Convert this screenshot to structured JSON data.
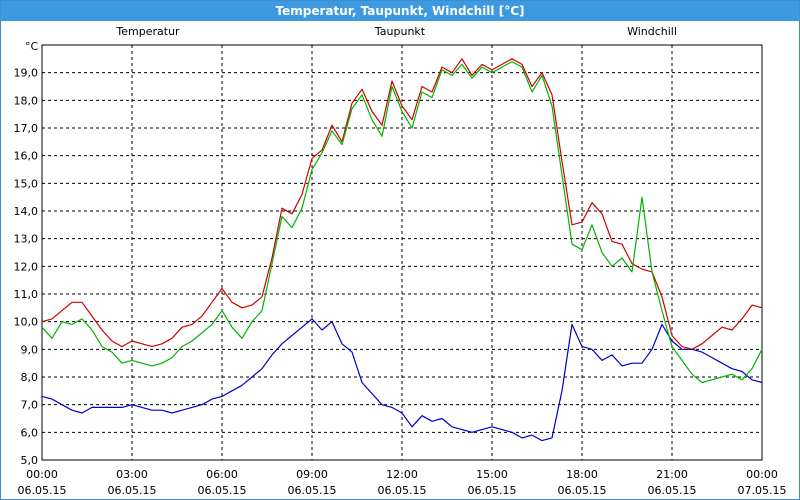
{
  "window": {
    "title": "Temperatur, Taupunkt, Windchill [°C]"
  },
  "chart_data": {
    "type": "line",
    "ylabel": "°C",
    "ylim": [
      5.0,
      20.0
    ],
    "xlim": [
      "2015-05-06T00:00",
      "2015-05-07T00:00"
    ],
    "grid": true,
    "yticks": [
      "5,0",
      "6,0",
      "7,0",
      "8,0",
      "9,0",
      "10,0",
      "11,0",
      "12,0",
      "13,0",
      "14,0",
      "15,0",
      "16,0",
      "17,0",
      "18,0",
      "19,0"
    ],
    "xticks": [
      {
        "time": "00:00",
        "date": "06.05.15"
      },
      {
        "time": "03:00",
        "date": "06.05.15"
      },
      {
        "time": "06:00",
        "date": "06.05.15"
      },
      {
        "time": "09:00",
        "date": "06.05.15"
      },
      {
        "time": "12:00",
        "date": "06.05.15"
      },
      {
        "time": "15:00",
        "date": "06.05.15"
      },
      {
        "time": "18:00",
        "date": "06.05.15"
      },
      {
        "time": "21:00",
        "date": "06.05.15"
      },
      {
        "time": "00:00",
        "date": "07.05.15"
      }
    ],
    "legend_placement": "top",
    "series": [
      {
        "name": "Temperatur",
        "color": "#d00000",
        "points": [
          [
            "00:00",
            10.0
          ],
          [
            "00:20",
            10.1
          ],
          [
            "00:40",
            10.4
          ],
          [
            "01:00",
            10.7
          ],
          [
            "01:20",
            10.7
          ],
          [
            "01:40",
            10.2
          ],
          [
            "02:00",
            9.7
          ],
          [
            "02:20",
            9.3
          ],
          [
            "02:40",
            9.1
          ],
          [
            "03:00",
            9.3
          ],
          [
            "03:20",
            9.2
          ],
          [
            "03:40",
            9.1
          ],
          [
            "04:00",
            9.2
          ],
          [
            "04:20",
            9.4
          ],
          [
            "04:40",
            9.8
          ],
          [
            "05:00",
            9.9
          ],
          [
            "05:20",
            10.2
          ],
          [
            "05:40",
            10.7
          ],
          [
            "06:00",
            11.2
          ],
          [
            "06:20",
            10.7
          ],
          [
            "06:40",
            10.5
          ],
          [
            "07:00",
            10.6
          ],
          [
            "07:20",
            10.9
          ],
          [
            "07:40",
            12.3
          ],
          [
            "08:00",
            14.1
          ],
          [
            "08:20",
            13.9
          ],
          [
            "08:40",
            14.6
          ],
          [
            "09:00",
            15.9
          ],
          [
            "09:20",
            16.2
          ],
          [
            "09:40",
            17.1
          ],
          [
            "10:00",
            16.5
          ],
          [
            "10:20",
            17.9
          ],
          [
            "10:40",
            18.4
          ],
          [
            "11:00",
            17.6
          ],
          [
            "11:20",
            17.1
          ],
          [
            "11:40",
            18.7
          ],
          [
            "12:00",
            17.8
          ],
          [
            "12:20",
            17.3
          ],
          [
            "12:40",
            18.5
          ],
          [
            "13:00",
            18.3
          ],
          [
            "13:20",
            19.2
          ],
          [
            "13:40",
            19.0
          ],
          [
            "14:00",
            19.5
          ],
          [
            "14:20",
            18.9
          ],
          [
            "14:40",
            19.3
          ],
          [
            "15:00",
            19.1
          ],
          [
            "15:20",
            19.3
          ],
          [
            "15:40",
            19.5
          ],
          [
            "16:00",
            19.3
          ],
          [
            "16:20",
            18.5
          ],
          [
            "16:40",
            19.0
          ],
          [
            "17:00",
            18.2
          ],
          [
            "17:20",
            15.8
          ],
          [
            "17:40",
            13.5
          ],
          [
            "18:00",
            13.6
          ],
          [
            "18:20",
            14.3
          ],
          [
            "18:40",
            13.9
          ],
          [
            "19:00",
            12.9
          ],
          [
            "19:20",
            12.8
          ],
          [
            "19:40",
            12.1
          ],
          [
            "20:00",
            11.9
          ],
          [
            "20:20",
            11.8
          ],
          [
            "20:40",
            10.9
          ],
          [
            "21:00",
            9.5
          ],
          [
            "21:20",
            9.1
          ],
          [
            "21:40",
            9.0
          ],
          [
            "22:00",
            9.2
          ],
          [
            "22:20",
            9.5
          ],
          [
            "22:40",
            9.8
          ],
          [
            "23:00",
            9.7
          ],
          [
            "23:20",
            10.1
          ],
          [
            "23:40",
            10.6
          ],
          [
            "24:00",
            10.5
          ]
        ]
      },
      {
        "name": "Taupunkt",
        "color": "#0000c8",
        "points": [
          [
            "00:00",
            7.3
          ],
          [
            "00:20",
            7.2
          ],
          [
            "00:40",
            7.0
          ],
          [
            "01:00",
            6.8
          ],
          [
            "01:20",
            6.7
          ],
          [
            "01:40",
            6.9
          ],
          [
            "02:00",
            6.9
          ],
          [
            "02:20",
            6.9
          ],
          [
            "02:40",
            6.9
          ],
          [
            "03:00",
            7.0
          ],
          [
            "03:20",
            6.9
          ],
          [
            "03:40",
            6.8
          ],
          [
            "04:00",
            6.8
          ],
          [
            "04:20",
            6.7
          ],
          [
            "04:40",
            6.8
          ],
          [
            "05:00",
            6.9
          ],
          [
            "05:20",
            7.0
          ],
          [
            "05:40",
            7.2
          ],
          [
            "06:00",
            7.3
          ],
          [
            "06:20",
            7.5
          ],
          [
            "06:40",
            7.7
          ],
          [
            "07:00",
            8.0
          ],
          [
            "07:20",
            8.3
          ],
          [
            "07:40",
            8.8
          ],
          [
            "08:00",
            9.2
          ],
          [
            "08:20",
            9.5
          ],
          [
            "08:40",
            9.8
          ],
          [
            "09:00",
            10.1
          ],
          [
            "09:20",
            9.7
          ],
          [
            "09:40",
            10.0
          ],
          [
            "10:00",
            9.2
          ],
          [
            "10:20",
            8.9
          ],
          [
            "10:40",
            7.8
          ],
          [
            "11:00",
            7.4
          ],
          [
            "11:20",
            7.0
          ],
          [
            "11:40",
            6.9
          ],
          [
            "12:00",
            6.7
          ],
          [
            "12:20",
            6.2
          ],
          [
            "12:40",
            6.6
          ],
          [
            "13:00",
            6.4
          ],
          [
            "13:20",
            6.5
          ],
          [
            "13:40",
            6.2
          ],
          [
            "14:00",
            6.1
          ],
          [
            "14:20",
            6.0
          ],
          [
            "14:40",
            6.1
          ],
          [
            "15:00",
            6.2
          ],
          [
            "15:20",
            6.1
          ],
          [
            "15:40",
            6.0
          ],
          [
            "16:00",
            5.8
          ],
          [
            "16:20",
            5.9
          ],
          [
            "16:40",
            5.7
          ],
          [
            "17:00",
            5.8
          ],
          [
            "17:20",
            7.5
          ],
          [
            "17:40",
            9.9
          ],
          [
            "18:00",
            9.1
          ],
          [
            "18:20",
            9.0
          ],
          [
            "18:40",
            8.6
          ],
          [
            "19:00",
            8.8
          ],
          [
            "19:20",
            8.4
          ],
          [
            "19:40",
            8.5
          ],
          [
            "20:00",
            8.5
          ],
          [
            "20:20",
            9.0
          ],
          [
            "20:40",
            9.9
          ],
          [
            "21:00",
            9.3
          ],
          [
            "21:20",
            9.0
          ],
          [
            "21:40",
            9.0
          ],
          [
            "22:00",
            8.9
          ],
          [
            "22:20",
            8.7
          ],
          [
            "22:40",
            8.5
          ],
          [
            "23:00",
            8.3
          ],
          [
            "23:20",
            8.2
          ],
          [
            "23:40",
            7.9
          ],
          [
            "24:00",
            7.8
          ]
        ]
      },
      {
        "name": "Windchill",
        "color": "#00b400",
        "points": [
          [
            "00:00",
            9.8
          ],
          [
            "00:20",
            9.4
          ],
          [
            "00:40",
            10.0
          ],
          [
            "01:00",
            9.9
          ],
          [
            "01:20",
            10.1
          ],
          [
            "01:40",
            9.7
          ],
          [
            "02:00",
            9.1
          ],
          [
            "02:20",
            8.9
          ],
          [
            "02:40",
            8.5
          ],
          [
            "03:00",
            8.6
          ],
          [
            "03:20",
            8.5
          ],
          [
            "03:40",
            8.4
          ],
          [
            "04:00",
            8.5
          ],
          [
            "04:20",
            8.7
          ],
          [
            "04:40",
            9.1
          ],
          [
            "05:00",
            9.3
          ],
          [
            "05:20",
            9.6
          ],
          [
            "05:40",
            9.9
          ],
          [
            "06:00",
            10.4
          ],
          [
            "06:20",
            9.8
          ],
          [
            "06:40",
            9.4
          ],
          [
            "07:00",
            10.0
          ],
          [
            "07:20",
            10.4
          ],
          [
            "07:40",
            12.1
          ],
          [
            "08:00",
            13.8
          ],
          [
            "08:20",
            13.4
          ],
          [
            "08:40",
            14.1
          ],
          [
            "09:00",
            15.5
          ],
          [
            "09:20",
            16.1
          ],
          [
            "09:40",
            16.9
          ],
          [
            "10:00",
            16.4
          ],
          [
            "10:20",
            17.7
          ],
          [
            "10:40",
            18.2
          ],
          [
            "11:00",
            17.3
          ],
          [
            "11:20",
            16.7
          ],
          [
            "11:40",
            18.5
          ],
          [
            "12:00",
            17.6
          ],
          [
            "12:20",
            17.0
          ],
          [
            "12:40",
            18.3
          ],
          [
            "13:00",
            18.1
          ],
          [
            "13:20",
            19.1
          ],
          [
            "13:40",
            18.9
          ],
          [
            "14:00",
            19.3
          ],
          [
            "14:20",
            18.8
          ],
          [
            "14:40",
            19.2
          ],
          [
            "15:00",
            19.0
          ],
          [
            "15:20",
            19.2
          ],
          [
            "15:40",
            19.4
          ],
          [
            "16:00",
            19.2
          ],
          [
            "16:20",
            18.3
          ],
          [
            "16:40",
            18.9
          ],
          [
            "17:00",
            17.8
          ],
          [
            "17:20",
            15.3
          ],
          [
            "17:40",
            12.8
          ],
          [
            "18:00",
            12.6
          ],
          [
            "18:20",
            13.5
          ],
          [
            "18:40",
            12.5
          ],
          [
            "19:00",
            12.0
          ],
          [
            "19:20",
            12.3
          ],
          [
            "19:40",
            11.8
          ],
          [
            "20:00",
            14.5
          ],
          [
            "20:20",
            11.8
          ],
          [
            "20:40",
            10.4
          ],
          [
            "21:00",
            9.1
          ],
          [
            "21:20",
            8.6
          ],
          [
            "21:40",
            8.1
          ],
          [
            "22:00",
            7.8
          ],
          [
            "22:20",
            7.9
          ],
          [
            "22:40",
            8.0
          ],
          [
            "23:00",
            8.1
          ],
          [
            "23:20",
            7.9
          ],
          [
            "23:40",
            8.3
          ],
          [
            "24:00",
            9.0
          ]
        ]
      }
    ]
  }
}
